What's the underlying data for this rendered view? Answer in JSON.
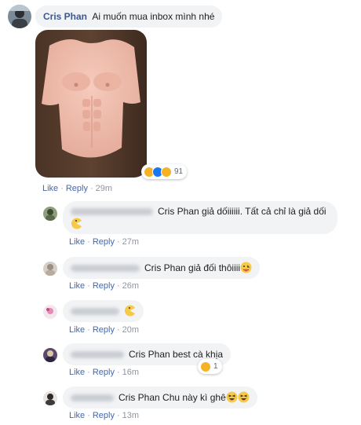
{
  "post": {
    "author": "Cris Phan",
    "text": "Ai muốn mua inbox mình nhé",
    "reaction_count": "91",
    "like": "Like",
    "reply": "Reply",
    "time": "29m",
    "reaction_icons": [
      "haha-icon",
      "like-icon",
      "wow-icon"
    ]
  },
  "replies": [
    {
      "mention": "Cris Phan",
      "text": "giả dốiiiiii. Tất cả chỉ là giả dối",
      "like": "Like",
      "reply": "Reply",
      "time": "27m"
    },
    {
      "mention": "Cris Phan",
      "text": "giả đối thôiiii",
      "like": "Like",
      "reply": "Reply",
      "time": "26m"
    },
    {
      "mention": "",
      "text": "",
      "like": "Like",
      "reply": "Reply",
      "time": "20m"
    },
    {
      "mention": "Cris Phan",
      "text": "best cà khịa",
      "like": "Like",
      "reply": "Reply",
      "time": "16m",
      "reaction_count": "1"
    },
    {
      "mention": "Cris Phan",
      "text": "Chu này kì ghê",
      "like": "Like",
      "reply": "Reply",
      "time": "13m"
    }
  ],
  "colors": {
    "author": "#385898",
    "link": "#4267b2",
    "meta": "#90949c",
    "bubble": "#f2f3f5"
  }
}
